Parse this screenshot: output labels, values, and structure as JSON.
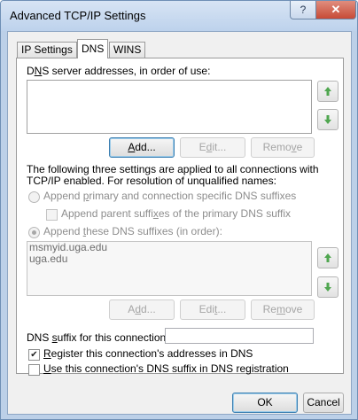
{
  "window": {
    "title": "Advanced TCP/IP Settings",
    "help_glyph": "?",
    "close_glyph": "✕"
  },
  "tabs": [
    {
      "label": "IP Settings"
    },
    {
      "label": "DNS"
    },
    {
      "label": "WINS"
    }
  ],
  "dns": {
    "server_label_pre": "D",
    "server_label_acc": "N",
    "server_label_post": "S server addresses, in order of use:",
    "server_list": [],
    "add_label_acc": "A",
    "add_label_post": "dd...",
    "edit_label_pre": "E",
    "edit_label_acc": "d",
    "edit_label_post": "it...",
    "remove_label_pre": "Remo",
    "remove_label_acc": "v",
    "remove_label_post": "e",
    "description": "The following three settings are applied to all connections with TCP/IP enabled. For resolution of unqualified names:",
    "opt_primary_pre": "Append ",
    "opt_primary_acc": "p",
    "opt_primary_post": "rimary and connection specific DNS suffixes",
    "opt_parent_pre": "Append parent suffi",
    "opt_parent_acc": "x",
    "opt_parent_post": "es of the primary DNS suffix",
    "opt_these_pre": "Append ",
    "opt_these_acc": "t",
    "opt_these_post": "hese DNS suffixes (in order):",
    "suffix_list": [
      "msmyid.uga.edu",
      "uga.edu"
    ],
    "add2_label_pre": "A",
    "add2_label_acc": "d",
    "add2_label_post": "d...",
    "edit2_label_pre": "Edi",
    "edit2_label_acc": "t",
    "edit2_label_post": "...",
    "remove2_label_pre": "Re",
    "remove2_label_acc": "m",
    "remove2_label_post": "ove",
    "conn_suffix_pre": "DNS ",
    "conn_suffix_acc": "s",
    "conn_suffix_post": "uffix for this connection:",
    "conn_suffix_value": "",
    "register_pre": "",
    "register_acc": "R",
    "register_post": "egister this connection's addresses in DNS",
    "register_checked": "✔",
    "use_suffix_pre": "",
    "use_suffix_acc": "U",
    "use_suffix_post": "se this connection's DNS suffix in DNS registration",
    "use_suffix_checked": ""
  },
  "footer": {
    "ok_label": "OK",
    "cancel_label": "Cancel"
  },
  "colors": {
    "arrow_green": "#4fa64f"
  }
}
